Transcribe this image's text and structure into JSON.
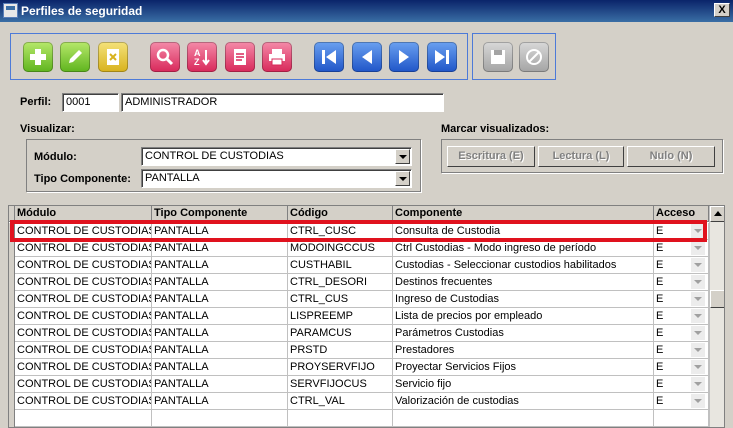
{
  "window": {
    "title": "Perfiles de seguridad",
    "close_glyph": "X"
  },
  "toolbar": {
    "group1": [
      {
        "name": "add-button",
        "icon": "plus-icon",
        "color": "#5fb41e"
      },
      {
        "name": "edit-button",
        "icon": "pencil-icon",
        "color": "#5fb41e"
      },
      {
        "name": "delete-button",
        "icon": "delete-doc-icon",
        "color": "#d8b21d"
      },
      {
        "name": "search-button",
        "icon": "magnifier-icon",
        "color": "#d8285a"
      },
      {
        "name": "sort-button",
        "icon": "sort-az-icon",
        "color": "#d8285a"
      },
      {
        "name": "report-button",
        "icon": "report-icon",
        "color": "#d8285a"
      },
      {
        "name": "print-button",
        "icon": "printer-icon",
        "color": "#d8285a"
      },
      {
        "name": "first-button",
        "icon": "first-record-icon",
        "color": "#1f55c8"
      },
      {
        "name": "previous-button",
        "icon": "previous-record-icon",
        "color": "#1f55c8"
      },
      {
        "name": "next-button",
        "icon": "next-record-icon",
        "color": "#1f55c8"
      },
      {
        "name": "last-button",
        "icon": "last-record-icon",
        "color": "#1f55c8"
      }
    ],
    "group2": [
      {
        "name": "save-button",
        "icon": "save-icon",
        "color": "#a4a4a4"
      },
      {
        "name": "cancel-button",
        "icon": "cancel-icon",
        "color": "#a4a4a4"
      }
    ]
  },
  "perfil": {
    "label": "Perfil:",
    "code": "0001",
    "name": "ADMINISTRADOR"
  },
  "visualizar": {
    "label": "Visualizar:",
    "modulo_label": "Módulo:",
    "modulo_value": "CONTROL DE CUSTODIAS",
    "tipo_label": "Tipo Componente:",
    "tipo_value": "PANTALLA"
  },
  "marcar": {
    "label": "Marcar visualizados:",
    "escritura": "Escritura (E)",
    "lectura": "Lectura (L)",
    "nulo": "Nulo (N)"
  },
  "grid": {
    "headers": [
      "Módulo",
      "Tipo Componente",
      "Código",
      "Componente",
      "Acceso"
    ],
    "rows": [
      [
        "CONTROL DE CUSTODIAS",
        "PANTALLA",
        "CTRL_CUSC",
        "Consulta de Custodia",
        "E"
      ],
      [
        "CONTROL DE CUSTODIAS",
        "PANTALLA",
        "MODOINGCCUS",
        "Ctrl Custodias - Modo ingreso de período",
        "E"
      ],
      [
        "CONTROL DE CUSTODIAS",
        "PANTALLA",
        "CUSTHABIL",
        "Custodias - Seleccionar custodios habilitados",
        "E"
      ],
      [
        "CONTROL DE CUSTODIAS",
        "PANTALLA",
        "CTRL_DESORI",
        "Destinos frecuentes",
        "E"
      ],
      [
        "CONTROL DE CUSTODIAS",
        "PANTALLA",
        "CTRL_CUS",
        "Ingreso de Custodias",
        "E"
      ],
      [
        "CONTROL DE CUSTODIAS",
        "PANTALLA",
        "LISPREEMP",
        "Lista de precios por empleado",
        "E"
      ],
      [
        "CONTROL DE CUSTODIAS",
        "PANTALLA",
        "PARAMCUS",
        "Parámetros Custodias",
        "E"
      ],
      [
        "CONTROL DE CUSTODIAS",
        "PANTALLA",
        "PRSTD",
        "Prestadores",
        "E"
      ],
      [
        "CONTROL DE CUSTODIAS",
        "PANTALLA",
        "PROYSERVFIJO",
        "Proyectar Servicios Fijos",
        "E"
      ],
      [
        "CONTROL DE CUSTODIAS",
        "PANTALLA",
        "SERVFIJOCUS",
        "Servicio fijo",
        "E"
      ],
      [
        "CONTROL DE CUSTODIAS",
        "PANTALLA",
        "CTRL_VAL",
        "Valorización de custodias",
        "E"
      ]
    ]
  },
  "colors": {
    "highlight": "#e0121e",
    "titlebar": "#0a246a",
    "toolbar_border": "#4d7ad8"
  }
}
